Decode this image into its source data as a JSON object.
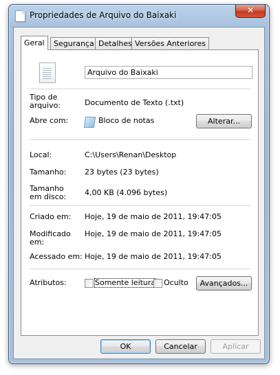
{
  "window": {
    "title": "Propriedades de Arquivo do Baixaki",
    "close_glyph": "✕"
  },
  "tabs": [
    {
      "label": "Geral",
      "active": true
    },
    {
      "label": "Segurança",
      "active": false
    },
    {
      "label": "Detalhes",
      "active": false
    },
    {
      "label": "Versões Anteriores",
      "active": false
    }
  ],
  "general": {
    "file_name": "Arquivo do Baixaki",
    "type_label": "Tipo de arquivo:",
    "type_value": "Documento de Texto (.txt)",
    "opens_with_label": "Abre com:",
    "opens_with_value": "Bloco de notas",
    "change_button": "Alterar...",
    "location_label": "Local:",
    "location_value": "C:\\Users\\Renan\\Desktop",
    "size_label": "Tamanho:",
    "size_value": "23 bytes (23 bytes)",
    "size_on_disk_label": "Tamanho em disco:",
    "size_on_disk_value": "4,00 KB (4.096 bytes)",
    "created_label": "Criado em:",
    "created_value": "Hoje, 19 de maio de 2011, 19:47:05",
    "modified_label": "Modificado em:",
    "modified_value": "Hoje, 19 de maio de 2011, 19:47:05",
    "accessed_label": "Acessado em:",
    "accessed_value": "Hoje, 19 de maio de 2011, 19:47:05",
    "attributes_label": "Atributos:",
    "readonly_label": "Somente leitura",
    "readonly_checked": false,
    "hidden_label": "Oculto",
    "hidden_checked": false,
    "advanced_button": "Avançados..."
  },
  "footer": {
    "ok": "OK",
    "cancel": "Cancelar",
    "apply": "Aplicar"
  }
}
